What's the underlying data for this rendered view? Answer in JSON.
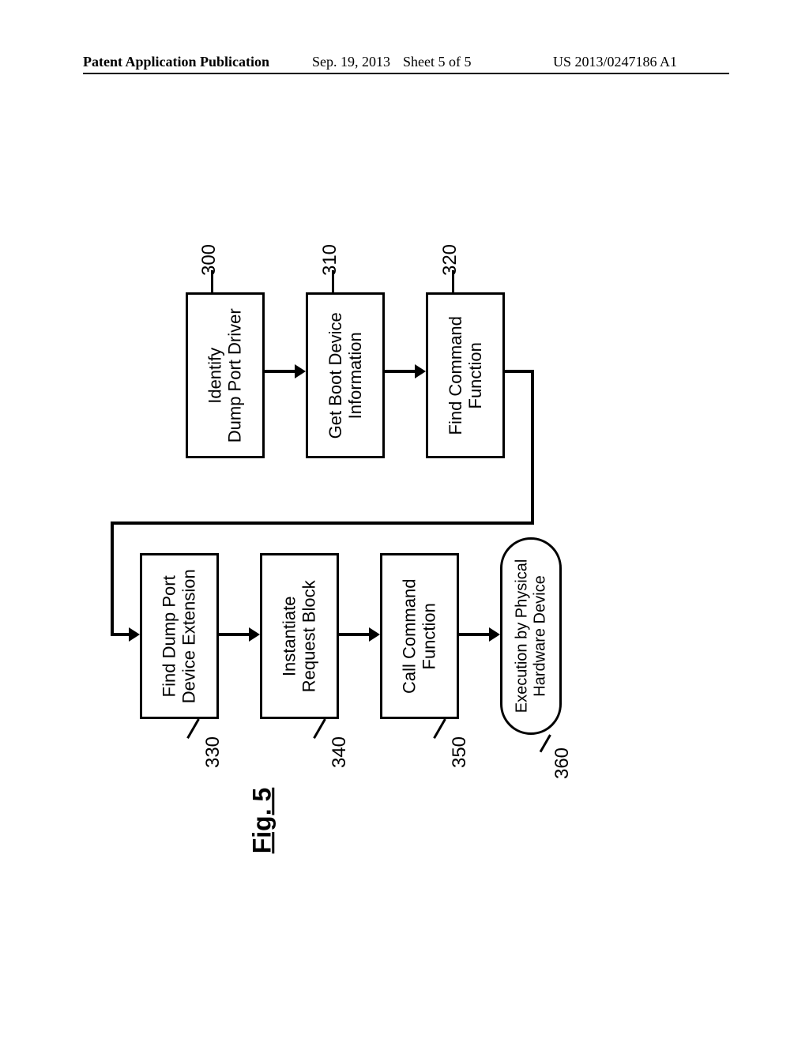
{
  "header": {
    "left": "Patent Application Publication",
    "date": "Sep. 19, 2013",
    "sheet": "Sheet 5 of 5",
    "pubno": "US 2013/0247186 A1"
  },
  "figure": {
    "label": "Fig. 5",
    "nodes": {
      "n300": {
        "ref": "300",
        "text": "Identify\nDump Port Driver"
      },
      "n310": {
        "ref": "310",
        "text": "Get Boot Device\nInformation"
      },
      "n320": {
        "ref": "320",
        "text": "Find Command\nFunction"
      },
      "n330": {
        "ref": "330",
        "text": "Find Dump Port\nDevice Extension"
      },
      "n340": {
        "ref": "340",
        "text": "Instantiate\nRequest Block"
      },
      "n350": {
        "ref": "350",
        "text": "Call Command\nFunction"
      },
      "n360": {
        "ref": "360",
        "text": "Execution by Physical\nHardware Device"
      }
    }
  },
  "chart_data": {
    "type": "flow",
    "title": "Fig. 5",
    "nodes": [
      {
        "id": "300",
        "label": "Identify Dump Port Driver",
        "shape": "process"
      },
      {
        "id": "310",
        "label": "Get Boot Device Information",
        "shape": "process"
      },
      {
        "id": "320",
        "label": "Find Command Function",
        "shape": "process"
      },
      {
        "id": "330",
        "label": "Find Dump Port Device Extension",
        "shape": "process"
      },
      {
        "id": "340",
        "label": "Instantiate Request Block",
        "shape": "process"
      },
      {
        "id": "350",
        "label": "Call Command Function",
        "shape": "process"
      },
      {
        "id": "360",
        "label": "Execution by Physical Hardware Device",
        "shape": "terminator"
      }
    ],
    "edges": [
      {
        "from": "300",
        "to": "310"
      },
      {
        "from": "310",
        "to": "320"
      },
      {
        "from": "320",
        "to": "330"
      },
      {
        "from": "330",
        "to": "340"
      },
      {
        "from": "340",
        "to": "350"
      },
      {
        "from": "350",
        "to": "360"
      }
    ]
  }
}
